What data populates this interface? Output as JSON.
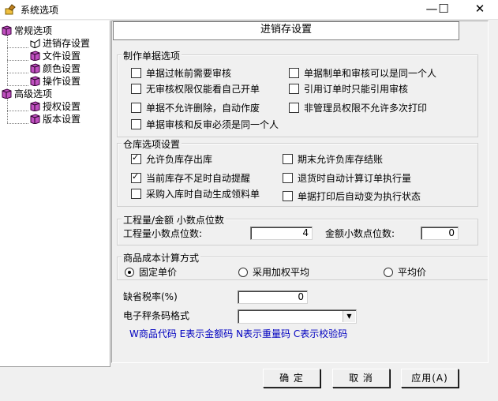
{
  "window": {
    "title": "系统选项",
    "minimize_glyph": "—",
    "maximize_glyph": "☐",
    "close_glyph": "✕"
  },
  "tree": {
    "groups": [
      {
        "label": "常规选项",
        "children": [
          "进销存设置",
          "文件设置",
          "颜色设置",
          "操作设置"
        ]
      },
      {
        "label": "高级选项",
        "children": [
          "授权设置",
          "版本设置"
        ]
      }
    ],
    "icon": "book-icon"
  },
  "panel": {
    "header": "进销存设置",
    "doc_group": {
      "legend": "制作单据选项",
      "options": [
        {
          "label": "单据过帐前需要审核",
          "checked": false
        },
        {
          "label": "单据制单和审核可以是同一个人",
          "checked": false
        },
        {
          "label": "无审核权限仅能看自己开单",
          "checked": false
        },
        {
          "label": "引用订单时只能引用审核",
          "checked": false
        },
        {
          "label": "单据不允许删除，自动作废",
          "checked": false
        },
        {
          "label": "非管理员权限不允许多次打印",
          "checked": false
        },
        {
          "label": "单据审核和反审必须是同一个人",
          "checked": false
        }
      ]
    },
    "warehouse_group": {
      "legend": "仓库选项设置",
      "options": [
        {
          "label": "允许负库存出库",
          "checked": true
        },
        {
          "label": "期末允许负库存结账",
          "checked": false
        },
        {
          "label": "当前库存不足时自动提醒",
          "checked": true
        },
        {
          "label": "退货时自动计算订单执行量",
          "checked": false
        },
        {
          "label": "采购入库时自动生成领料单",
          "checked": false
        },
        {
          "label": "单据打印后自动变为执行状态",
          "checked": false
        }
      ]
    },
    "decimal_group": {
      "legend": "工程量/金额 小数点位数",
      "qty_label": "工程量小数点位数:",
      "qty_value": "4",
      "amount_label": "金额小数点位数:",
      "amount_value": "0"
    },
    "cost_group": {
      "legend": "商品成本计算方式",
      "options": [
        {
          "label": "固定单价",
          "selected": true
        },
        {
          "label": "采用加权平均",
          "selected": false
        },
        {
          "label": "平均价",
          "selected": false
        }
      ]
    },
    "tax_label": "缺省税率(%)",
    "tax_value": "0",
    "barcode_label": "电子秤条码格式",
    "barcode_value": "",
    "barcode_hint": "W商品代码 E表示金额码 N表示重量码 C表示校验码"
  },
  "buttons": {
    "ok": "确 定",
    "cancel": "取 消",
    "apply": "应用(A)"
  }
}
